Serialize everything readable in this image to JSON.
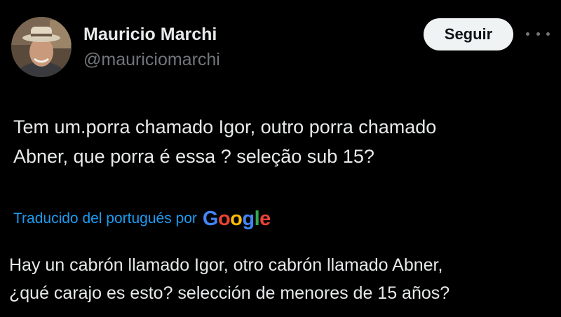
{
  "author": {
    "display_name": "Mauricio Marchi",
    "handle": "@mauriciomarchi"
  },
  "actions": {
    "follow_label": "Seguir",
    "more_icon": "more-horizontal-icon"
  },
  "tweet": {
    "text_line1": "Tem um.porra chamado Igor, outro porra chamado",
    "text_line2": "Abner, que porra é essa ? seleção sub 15?"
  },
  "translation": {
    "label": "Traducido del portugués por",
    "provider": "Google",
    "text_line1": "Hay un cabrón llamado Igor, otro cabrón llamado Abner,",
    "text_line2": "¿qué carajo es esto? selección de menores de 15 años?"
  },
  "colors": {
    "background": "#000000",
    "text_primary": "#e7e9ea",
    "text_secondary": "#71767b",
    "link_blue": "#1d9bf0",
    "google_blue": "#4285f4",
    "google_red": "#ea4335",
    "google_yellow": "#fbbc05",
    "google_green": "#34a853"
  }
}
